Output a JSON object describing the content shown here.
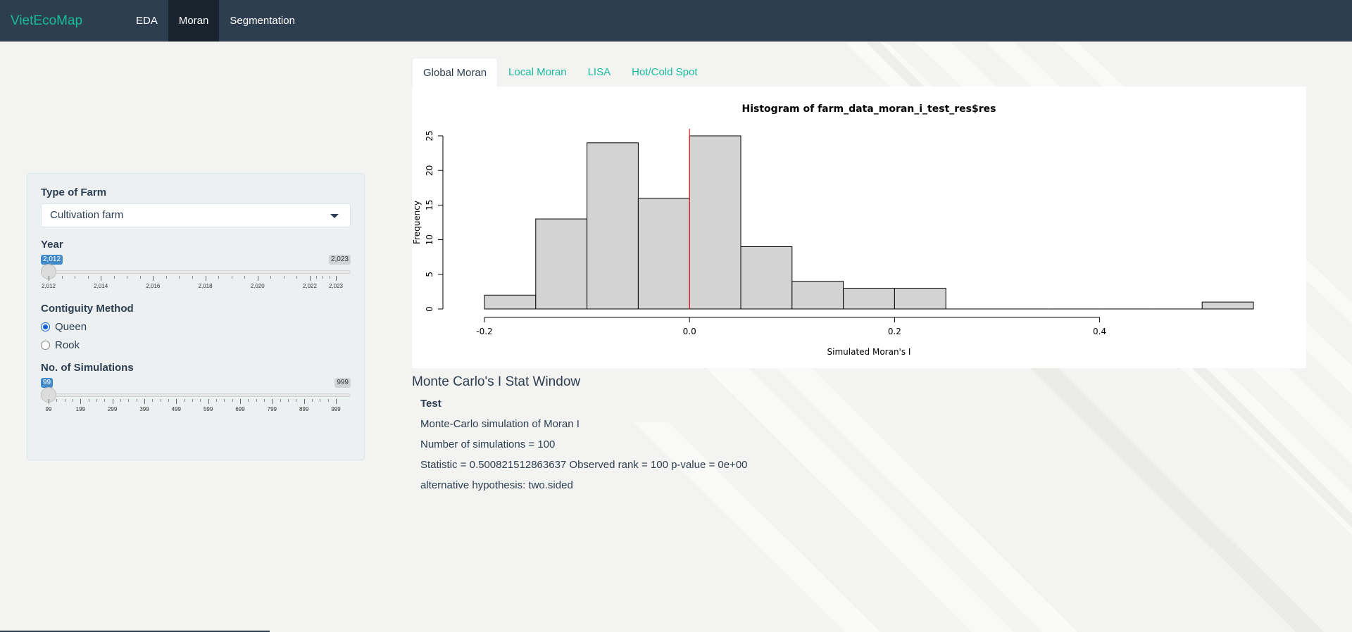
{
  "app": {
    "brand": "VietEcoMap"
  },
  "nav": {
    "items": [
      {
        "label": "EDA",
        "active": false
      },
      {
        "label": "Moran",
        "active": true
      },
      {
        "label": "Segmentation",
        "active": false
      }
    ]
  },
  "sidebar": {
    "farm_type": {
      "label": "Type of Farm",
      "value": "Cultivation farm"
    },
    "year": {
      "label": "Year",
      "min_label": "2,012",
      "max_label": "2,023",
      "ticks": [
        "2,012",
        "2,014",
        "2,016",
        "2,018",
        "2,020",
        "2,022",
        "2,023"
      ]
    },
    "contiguity": {
      "label": "Contiguity Method",
      "options": [
        "Queen",
        "Rook"
      ],
      "selected": "Queen"
    },
    "simulations": {
      "label": "No. of Simulations",
      "min_label": "99",
      "max_label": "999",
      "ticks": [
        "99",
        "199",
        "299",
        "399",
        "499",
        "599",
        "699",
        "799",
        "899",
        "999"
      ]
    }
  },
  "tabs": [
    {
      "label": "Global Moran",
      "active": true
    },
    {
      "label": "Local Moran",
      "active": false
    },
    {
      "label": "LISA",
      "active": false
    },
    {
      "label": "Hot/Cold Spot",
      "active": false
    }
  ],
  "chart_data": {
    "type": "bar",
    "title": "Histogram of farm_data_moran_i_test_res$res",
    "xlabel": "Simulated Moran's I",
    "ylabel": "Frequency",
    "bin_edges": [
      -0.2,
      -0.15,
      -0.1,
      -0.05,
      0.0,
      0.05,
      0.1,
      0.15,
      0.2,
      0.25,
      0.3,
      0.35,
      0.4,
      0.45,
      0.5,
      0.55
    ],
    "values": [
      2,
      13,
      24,
      16,
      25,
      9,
      4,
      3,
      3,
      0,
      0,
      0,
      0,
      0,
      1
    ],
    "xticks": [
      -0.2,
      0.0,
      0.2,
      0.4
    ],
    "xtick_labels": [
      "-0.2",
      "0.0",
      "0.2",
      "0.4"
    ],
    "yticks": [
      0,
      5,
      10,
      15,
      20,
      25
    ],
    "ytick_labels": [
      "0",
      "5",
      "10",
      "15",
      "20",
      "25"
    ],
    "xlim": [
      -0.2,
      0.55
    ],
    "ylim": [
      0,
      25
    ],
    "observed_line": 0.0,
    "bar_color": "#d3d3d3",
    "line_color": "#e41a1c"
  },
  "stat": {
    "title": "Monte Carlo's I Stat Window",
    "heading": "Test",
    "lines": [
      "Monte-Carlo simulation of Moran I",
      "Number of simulations = 100",
      "Statistic = 0.500821512863637 Observed rank = 100 p-value = 0e+00",
      "alternative hypothesis: two.sided"
    ]
  },
  "colors": {
    "navbar": "#2c3e50",
    "accent": "#18bc9c",
    "slider_badge": "#428bca"
  }
}
